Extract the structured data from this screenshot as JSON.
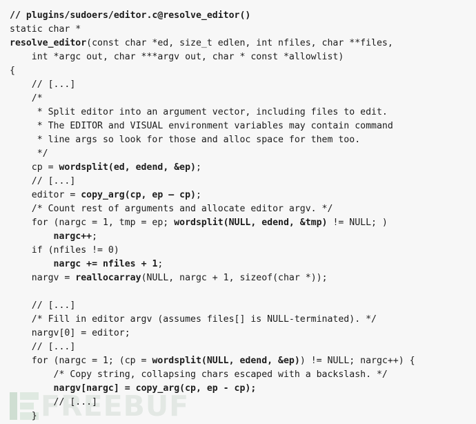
{
  "code": {
    "language": "c",
    "source_reference": "// plugins/sudoers/editor.c@resolve_editor()",
    "background_color": "#f7f7f7",
    "text_color": "#1b1b1b",
    "lines": [
      {
        "indent": 0,
        "segments": [
          {
            "text": "// plugins/sudoers/editor.c@resolve_editor()",
            "bold": true
          }
        ]
      },
      {
        "indent": 0,
        "segments": [
          {
            "text": "static char *",
            "bold": false
          }
        ]
      },
      {
        "indent": 0,
        "segments": [
          {
            "text": "resolve_editor",
            "bold": true
          },
          {
            "text": "(const char *ed, size_t edlen, int nfiles, char **files,",
            "bold": false
          }
        ]
      },
      {
        "indent": 0,
        "segments": [
          {
            "text": "    int *argc out, char ***argv out, char * const *allowlist)",
            "bold": false
          }
        ]
      },
      {
        "indent": 0,
        "segments": [
          {
            "text": "{",
            "bold": false
          }
        ]
      },
      {
        "indent": 0,
        "segments": [
          {
            "text": "    // [...]",
            "bold": false
          }
        ]
      },
      {
        "indent": 0,
        "segments": [
          {
            "text": "    /*",
            "bold": false
          }
        ]
      },
      {
        "indent": 0,
        "segments": [
          {
            "text": "     * Split editor into an argument vector, including files to edit.",
            "bold": false
          }
        ]
      },
      {
        "indent": 0,
        "segments": [
          {
            "text": "     * The EDITOR and VISUAL environment variables may contain command",
            "bold": false
          }
        ]
      },
      {
        "indent": 0,
        "segments": [
          {
            "text": "     * line args so look for those and alloc space for them too.",
            "bold": false
          }
        ]
      },
      {
        "indent": 0,
        "segments": [
          {
            "text": "     */",
            "bold": false
          }
        ]
      },
      {
        "indent": 0,
        "segments": [
          {
            "text": "    cp = ",
            "bold": false
          },
          {
            "text": "wordsplit(ed, edend, &ep)",
            "bold": true
          },
          {
            "text": ";",
            "bold": false
          }
        ]
      },
      {
        "indent": 0,
        "segments": [
          {
            "text": "    // [...]",
            "bold": false
          }
        ]
      },
      {
        "indent": 0,
        "segments": [
          {
            "text": "    editor = ",
            "bold": false
          },
          {
            "text": "copy_arg(cp, ep – cp)",
            "bold": true
          },
          {
            "text": ";",
            "bold": false
          }
        ]
      },
      {
        "indent": 0,
        "segments": [
          {
            "text": "    /* Count rest of arguments and allocate editor argv. */",
            "bold": false
          }
        ]
      },
      {
        "indent": 0,
        "segments": [
          {
            "text": "    for (nargc = 1, tmp = ep; ",
            "bold": false
          },
          {
            "text": "wordsplit(NULL, edend, &tmp)",
            "bold": true
          },
          {
            "text": " != NULL; )",
            "bold": false
          }
        ]
      },
      {
        "indent": 0,
        "segments": [
          {
            "text": "        ",
            "bold": false
          },
          {
            "text": "nargc++",
            "bold": true
          },
          {
            "text": ";",
            "bold": false
          }
        ]
      },
      {
        "indent": 0,
        "segments": [
          {
            "text": "    if (nfiles != 0)",
            "bold": false
          }
        ]
      },
      {
        "indent": 0,
        "segments": [
          {
            "text": "        ",
            "bold": false
          },
          {
            "text": "nargc += nfiles + 1",
            "bold": true
          },
          {
            "text": ";",
            "bold": false
          }
        ]
      },
      {
        "indent": 0,
        "segments": [
          {
            "text": "    nargv = ",
            "bold": false
          },
          {
            "text": "reallocarray",
            "bold": true
          },
          {
            "text": "(NULL, nargc + 1, sizeof(char *));",
            "bold": false
          }
        ]
      },
      {
        "indent": 0,
        "segments": [
          {
            "text": "",
            "bold": false
          }
        ]
      },
      {
        "indent": 0,
        "segments": [
          {
            "text": "    // [...]",
            "bold": false
          }
        ]
      },
      {
        "indent": 0,
        "segments": [
          {
            "text": "    /* Fill in editor argv (assumes files[] is NULL-terminated). */",
            "bold": false
          }
        ]
      },
      {
        "indent": 0,
        "segments": [
          {
            "text": "    nargv[0] = editor;",
            "bold": false
          }
        ]
      },
      {
        "indent": 0,
        "segments": [
          {
            "text": "    // [...]",
            "bold": false
          }
        ]
      },
      {
        "indent": 0,
        "segments": [
          {
            "text": "    for (nargc = 1; (cp = ",
            "bold": false
          },
          {
            "text": "wordsplit(NULL, edend, &ep)",
            "bold": true
          },
          {
            "text": ") != NULL; nargc++) {",
            "bold": false
          }
        ]
      },
      {
        "indent": 0,
        "segments": [
          {
            "text": "        /* Copy string, collapsing chars escaped with a backslash. */",
            "bold": false
          }
        ]
      },
      {
        "indent": 0,
        "segments": [
          {
            "text": "        ",
            "bold": false
          },
          {
            "text": "nargv[nargc] = copy_arg(cp, ep - cp);",
            "bold": true
          }
        ]
      },
      {
        "indent": 0,
        "segments": [
          {
            "text": "        // [...]",
            "bold": false
          }
        ]
      },
      {
        "indent": 0,
        "segments": [
          {
            "text": "    }",
            "bold": false
          }
        ]
      }
    ]
  },
  "watermark": {
    "text": "FREEBUF",
    "mark_color": "#cfded2",
    "text_color": "#e3e8e4"
  }
}
